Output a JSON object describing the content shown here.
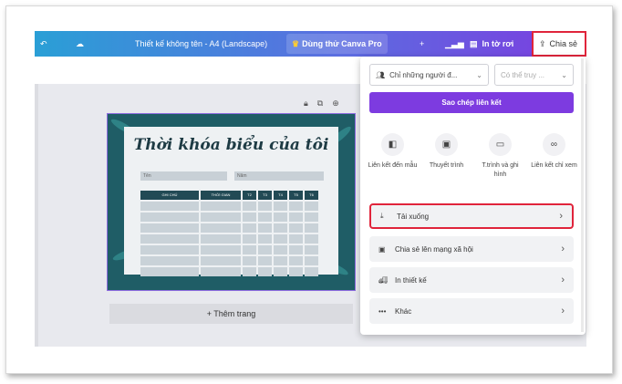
{
  "topbar": {
    "title": "Thiết kế không tên - A4 (Landscape)",
    "trial": "Dùng thử Canva Pro",
    "print": "In tờ rơi",
    "share": "Chia sẻ"
  },
  "design": {
    "heading": "Thời khóa biểu của tôi",
    "field_name": "Tên",
    "field_year": "Năm",
    "columns": [
      "GHI CHÚ",
      "THỜI GIAN",
      "T2",
      "T3",
      "T4",
      "T5",
      "T6"
    ]
  },
  "canvas": {
    "add_page": "+ Thêm trang"
  },
  "panel": {
    "access_select": "Chỉ những người đ...",
    "permission_select": "Có thể truy ...",
    "copy_link": "Sao chép liên kết",
    "options": [
      {
        "label": "Liên kết đến mẫu",
        "icon": "template-icon"
      },
      {
        "label": "Thuyết trình",
        "icon": "present-icon"
      },
      {
        "label": "T.trình và ghi hình",
        "icon": "record-icon"
      },
      {
        "label": "Liên kết chỉ xem",
        "icon": "link-icon"
      }
    ],
    "download": "Tải xuống",
    "social": "Chia sẻ lên mạng xã hội",
    "print_design": "In thiết kế",
    "more": "Khác"
  },
  "colors": {
    "accent": "#7d3be0",
    "highlight": "#e0243b",
    "topbar_start": "#2a9fd6"
  }
}
